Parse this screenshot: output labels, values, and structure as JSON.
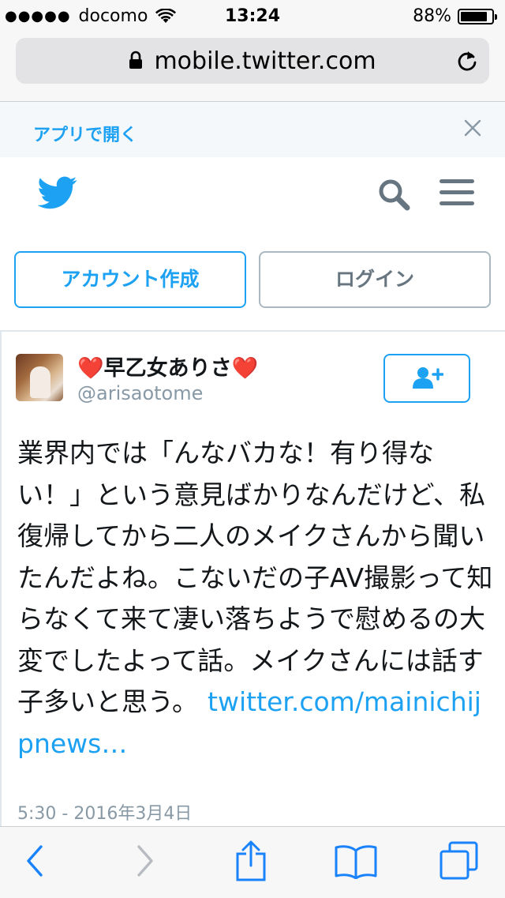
{
  "status_bar": {
    "carrier": "docomo",
    "time": "13:24",
    "battery_percent": "88%",
    "battery_level": 0.88
  },
  "browser": {
    "url": "mobile.twitter.com"
  },
  "app_banner": {
    "open_app_label": "アプリで開く"
  },
  "auth": {
    "signup_label": "アカウント作成",
    "login_label": "ログイン"
  },
  "tweet": {
    "display_name": "早乙女ありさ",
    "handle": "@arisaotome",
    "text": "業界内では「んなバカな！有り得ない！」という意見ばかりなんだけど、私復帰してから二人のメイクさんから聞いたんだよね。こないだの子AV撮影って知らなくて来て凄い落ちようで慰めるの大変でしたよって話。メイクさんには話す子多いと思う。",
    "link": "twitter.com/mainichijpnews…",
    "timestamp": "5:30 - 2016年3月4日"
  },
  "colors": {
    "accent": "#1da1f2",
    "muted": "#8899a6",
    "heart": "#e0245e"
  },
  "icons": [
    "wifi-icon",
    "lock-icon",
    "reload-icon",
    "close-icon",
    "twitter-bird-icon",
    "search-icon",
    "menu-icon",
    "follow-user-icon",
    "back-icon",
    "forward-icon",
    "share-icon",
    "bookmarks-icon",
    "tabs-icon"
  ]
}
